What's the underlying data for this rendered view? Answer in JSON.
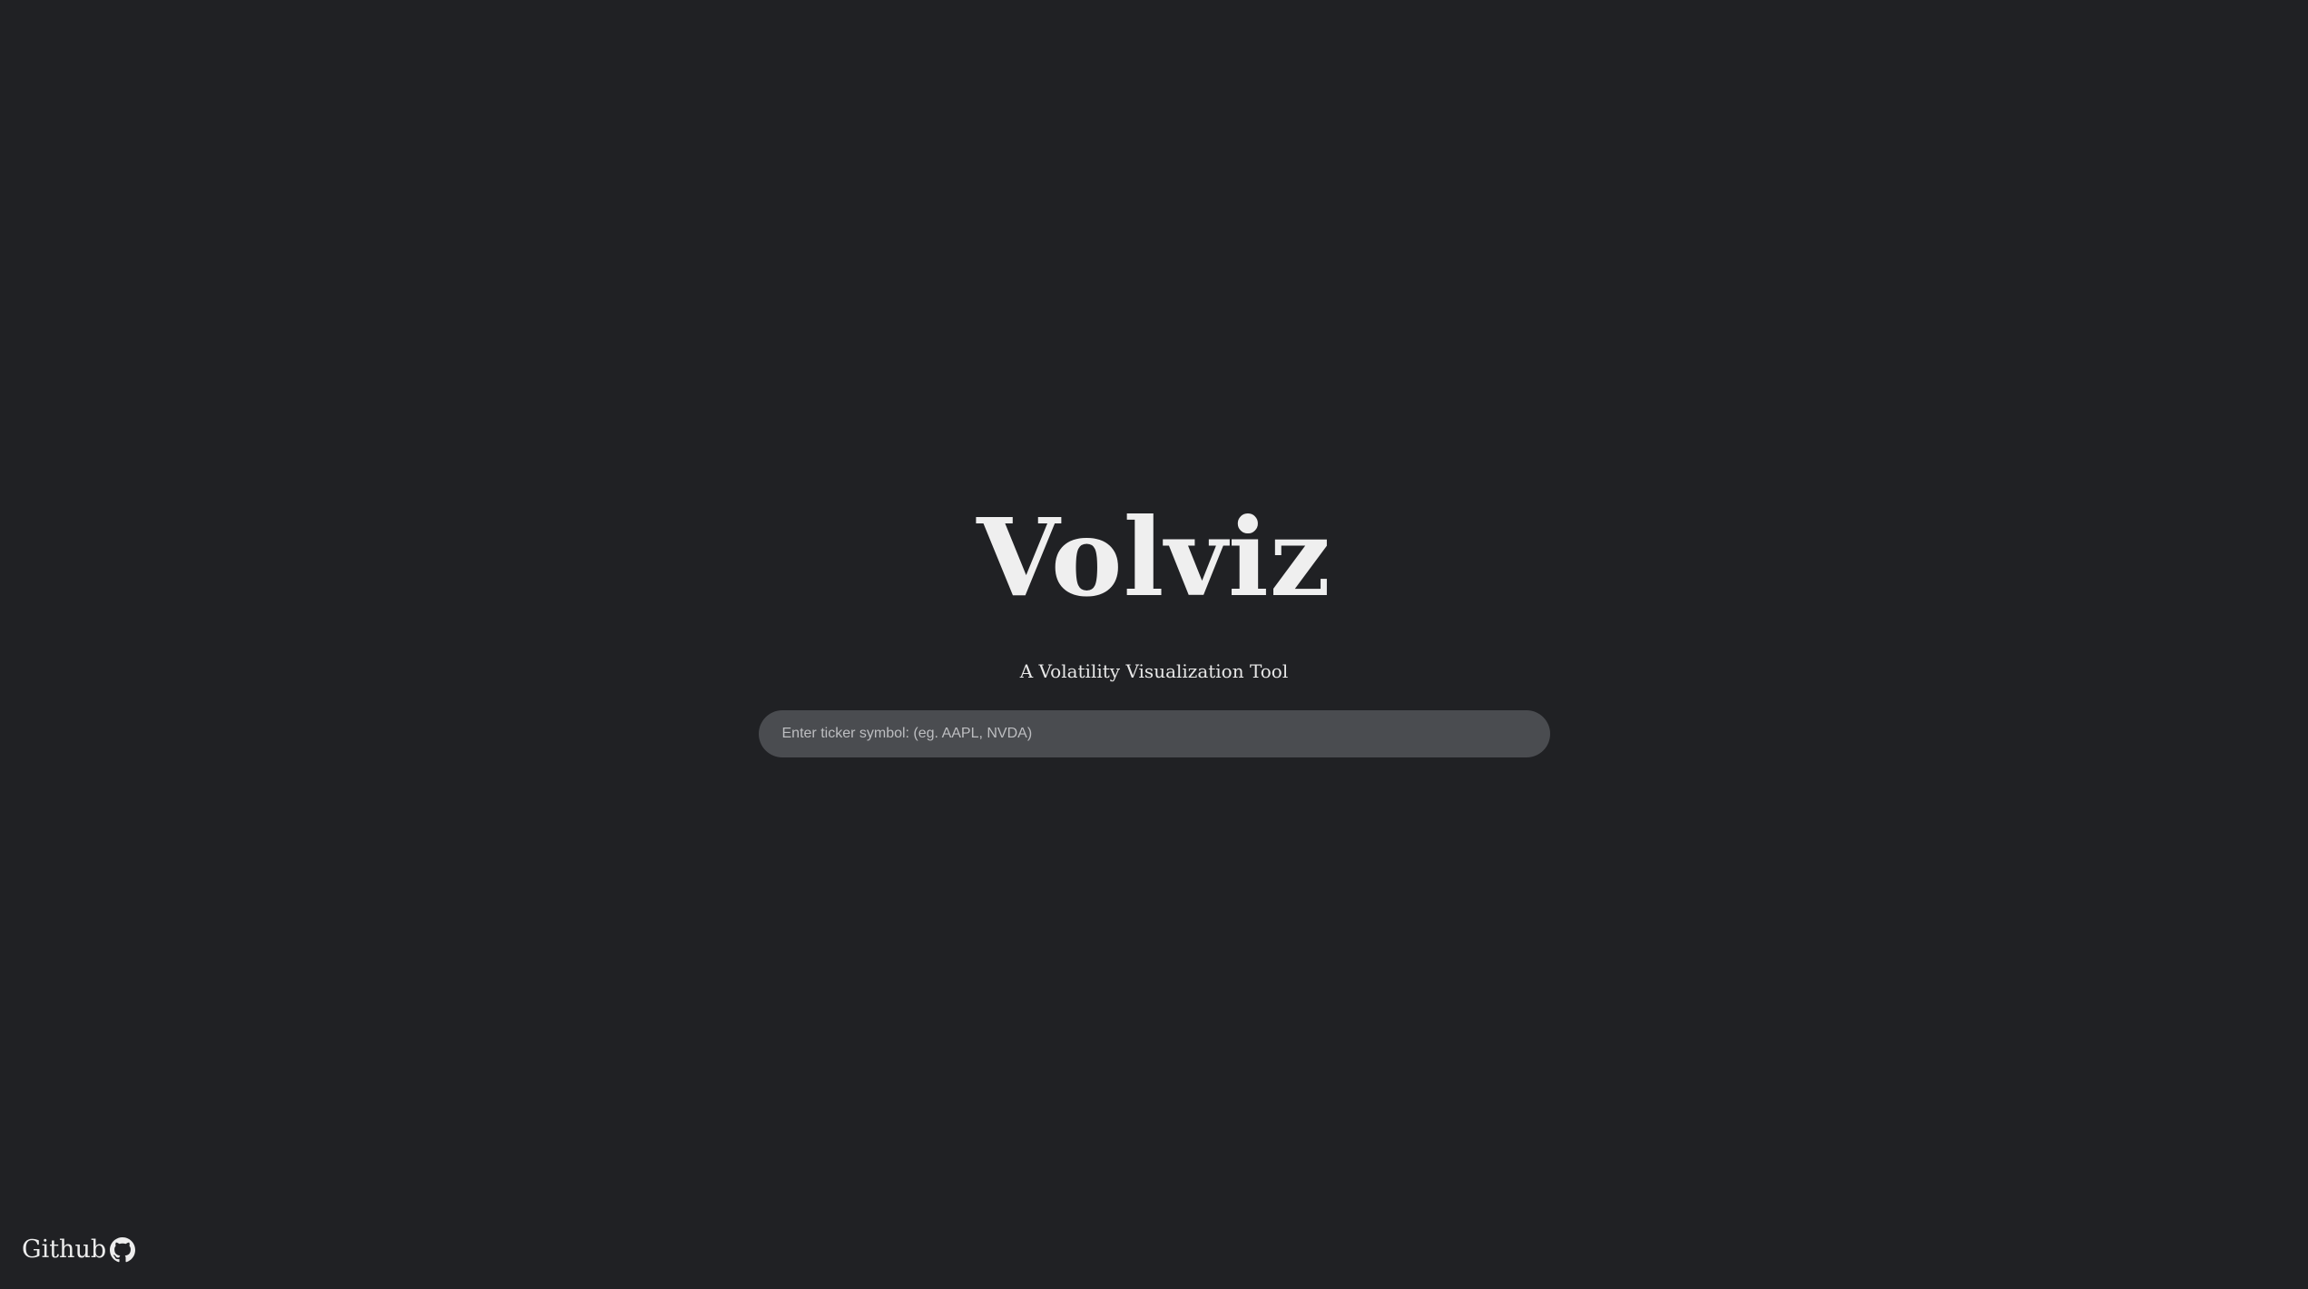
{
  "app": {
    "title": "Volviz",
    "subtitle": "A Volatility Visualization Tool"
  },
  "search": {
    "placeholder": "Enter ticker symbol: (eg. AAPL, NVDA)",
    "value": ""
  },
  "footer": {
    "link_label": "Github",
    "icon": "github-icon"
  },
  "colors": {
    "background": "#202124",
    "input_background": "#4a4c50",
    "text": "#efefef"
  }
}
